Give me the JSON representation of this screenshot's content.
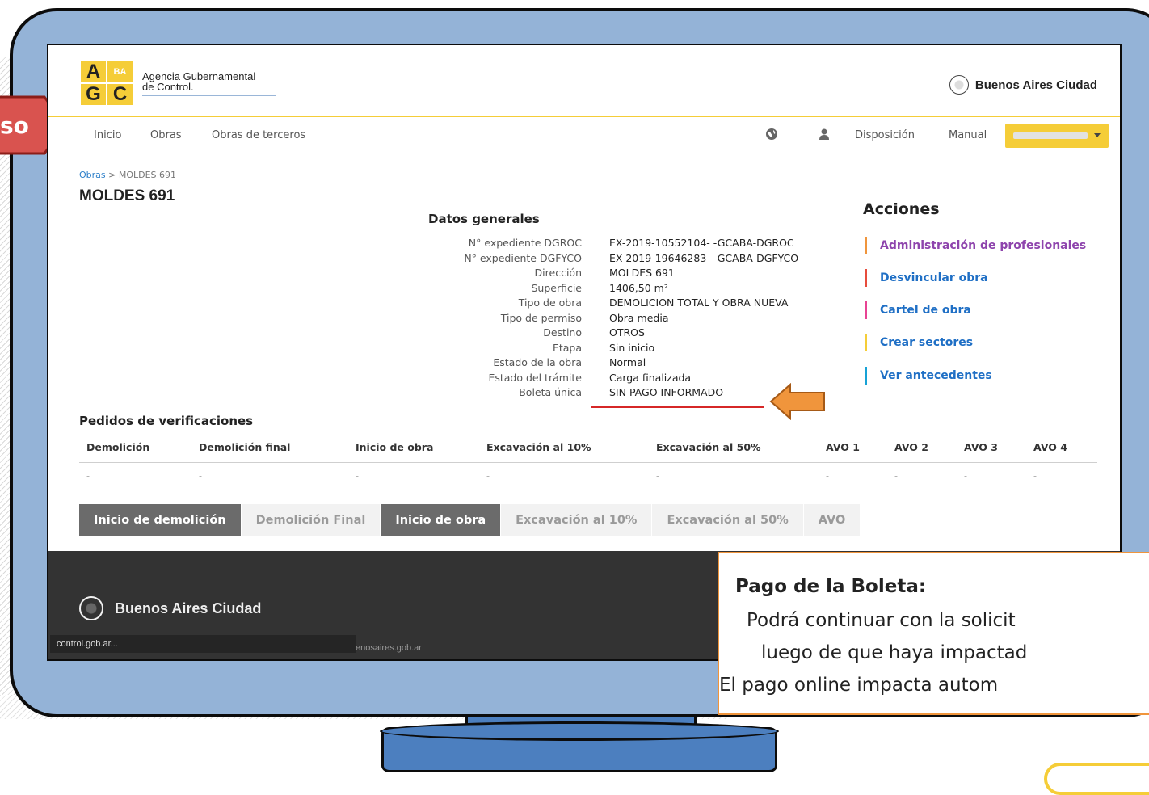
{
  "brand": {
    "logo_letters": [
      "A",
      "BA",
      "G",
      "C"
    ],
    "agency_name_line1": "Agencia Gubernamental",
    "agency_name_line2": "de Control.",
    "city_brand": "Buenos Aires Ciudad"
  },
  "callout_tab": {
    "text": "so"
  },
  "nav": {
    "items": [
      "Inicio",
      "Obras",
      "Obras de terceros"
    ],
    "right_links": [
      "Disposición",
      "Manual"
    ]
  },
  "breadcrumb": {
    "parent": "Obras",
    "separator": ">",
    "current": "MOLDES 691"
  },
  "page_title": "MOLDES 691",
  "datos_generales": {
    "heading": "Datos generales",
    "rows": [
      {
        "label": "N° expediente DGROC",
        "value": "EX-2019-10552104- -GCABA-DGROC"
      },
      {
        "label": "N° expediente DGFYCO",
        "value": "EX-2019-19646283- -GCABA-DGFYCO"
      },
      {
        "label": "Dirección",
        "value": "MOLDES 691"
      },
      {
        "label": "Superficie",
        "value": "1406,50 m²"
      },
      {
        "label": "Tipo de obra",
        "value": "DEMOLICION TOTAL Y OBRA NUEVA"
      },
      {
        "label": "Tipo de permiso",
        "value": "Obra media"
      },
      {
        "label": "Destino",
        "value": "OTROS"
      },
      {
        "label": "Etapa",
        "value": "Sin inicio"
      },
      {
        "label": "Estado de la obra",
        "value": "Normal"
      },
      {
        "label": "Estado del trámite",
        "value": "Carga finalizada"
      },
      {
        "label": "Boleta única",
        "value": "SIN PAGO INFORMADO"
      }
    ]
  },
  "acciones": {
    "heading": "Acciones",
    "items": [
      {
        "label": "Administración de profesionales",
        "bar_color": "#f0953c",
        "text_color": "#8e44ad"
      },
      {
        "label": "Desvincular obra",
        "bar_color": "#e74c3c",
        "text_color": "#1f6fc5"
      },
      {
        "label": "Cartel de obra",
        "bar_color": "#e84393",
        "text_color": "#1f6fc5"
      },
      {
        "label": "Crear sectores",
        "bar_color": "#f5cd38",
        "text_color": "#1f6fc5"
      },
      {
        "label": "Ver antecedentes",
        "bar_color": "#17a2d6",
        "text_color": "#1f6fc5"
      }
    ]
  },
  "pedidos": {
    "heading": "Pedidos de verificaciones",
    "columns": [
      "Demolición",
      "Demolición final",
      "Inicio de obra",
      "Excavación al 10%",
      "Excavación al 50%",
      "AVO 1",
      "AVO 2",
      "AVO 3",
      "AVO 4"
    ],
    "values": [
      "-",
      "-",
      "-",
      "-",
      "-",
      "-",
      "-",
      "-",
      "-"
    ]
  },
  "tabs": [
    {
      "label": "Inicio de demolición",
      "active": true
    },
    {
      "label": "Demolición Final",
      "active": false
    },
    {
      "label": "Inicio de obra",
      "active": true
    },
    {
      "label": "Excavación al 10%",
      "active": false
    },
    {
      "label": "Excavación al 50%",
      "active": false
    },
    {
      "label": "AVO",
      "active": false
    }
  ],
  "footer": {
    "brand": "Buenos Aires Ciudad",
    "status_left": "control.gob.ar...",
    "status_right": "enosaires.gob.ar"
  },
  "note": {
    "title": "Pago de la Boleta:",
    "line1": "Podrá continuar con la solicit",
    "line2": "luego de que haya impactad",
    "line3": "El pago online impacta autom"
  },
  "colors": {
    "monitor_frame": "#94b3d7",
    "monitor_stand": "#4c7fbf",
    "accent_yellow": "#f5cd38",
    "arrow_orange": "#f0953c",
    "highlight_red": "#d62727",
    "footer_dark": "#333333"
  }
}
